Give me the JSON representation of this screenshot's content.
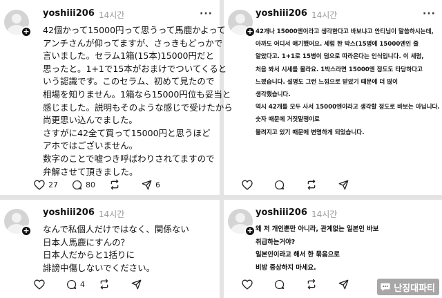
{
  "posts": [
    {
      "username": "yoshiii206",
      "time": "14시간",
      "more": "···",
      "lines": [
        "42個かって15000円って思うって馬鹿かよって",
        "アンチさんが仰ってますが、さっきもどっかで",
        "言いました。セラム1箱(15本)15000円だと",
        "思ったと。1+1で15本がおまけでついてくると",
        "いう認識です。このセラム、初めて見たので",
        "相場を知りません。1箱なら15000円位も妥当と",
        "感じました。説明もそのような感じで受けたから",
        "尚更思い込んでました。",
        "さすがに42全て買って15000円と思うほど",
        "アホではございません。",
        "数字のことで嘘つき呼ばわりされてますので",
        "弁解させて頂きました。"
      ],
      "likes": "27",
      "comments": "80",
      "reposts": "",
      "shares": "6"
    },
    {
      "username": "yoshiii206",
      "time": "14시간",
      "more": "···",
      "lines": [
        "42개나 15000엔이라고 생각한다고 바보냐고 안티님이 말씀하시는데,",
        "아까도 어디서 얘기했어요. 세럼 한 박스(15병에 15000엔인 줄",
        "알았다고. 1+1로 15병이 덤으로 따라온다는 인식입니다. 이 세럼,",
        "처음 봐서 시세를 몰라요. 1박스라면 15000엔 정도도 타당하다고",
        "느꼈습니다. 설명도 그런 느낌으로 받았기 때문에 더 많이",
        "생각했습니다.",
        "역시 42개를 모두 사서 15000엔이라고 생각할 정도로 바보는 아닙니다.",
        "숫자 때문에 거짓말쟁이로",
        "불려지고 있기 때문에 변명하게 되었습니다."
      ],
      "likes": "",
      "comments": "",
      "reposts": "",
      "shares": ""
    },
    {
      "username": "yoshiii206",
      "time": "14시간",
      "more": "···",
      "lines": [
        "なんで私個人だけではなく、関係ない",
        "日本人馬鹿にすんの？",
        "日本人だからと1括りに",
        "誹謗中傷しないでください。"
      ],
      "likes": "",
      "comments": "4",
      "reposts": "",
      "shares": ""
    },
    {
      "username": "yoshiii206",
      "time": "14시간",
      "more": "···",
      "lines": [
        "왜 저 개인뿐만 아니라, 관계없는 일본인 바보",
        "취급하는거야?",
        "일본인이라고 해서 한 묶음으로",
        "비방 중상하지 마세요."
      ],
      "likes": "",
      "comments": "",
      "reposts": "",
      "shares": ""
    }
  ],
  "watermark": {
    "text": "난징대파티",
    "icon": "chat-bubble-icon",
    "color": "#ffffff"
  },
  "icons": {
    "like": "heart-icon",
    "comment": "comment-icon",
    "repost": "repost-icon",
    "share": "send-icon"
  }
}
